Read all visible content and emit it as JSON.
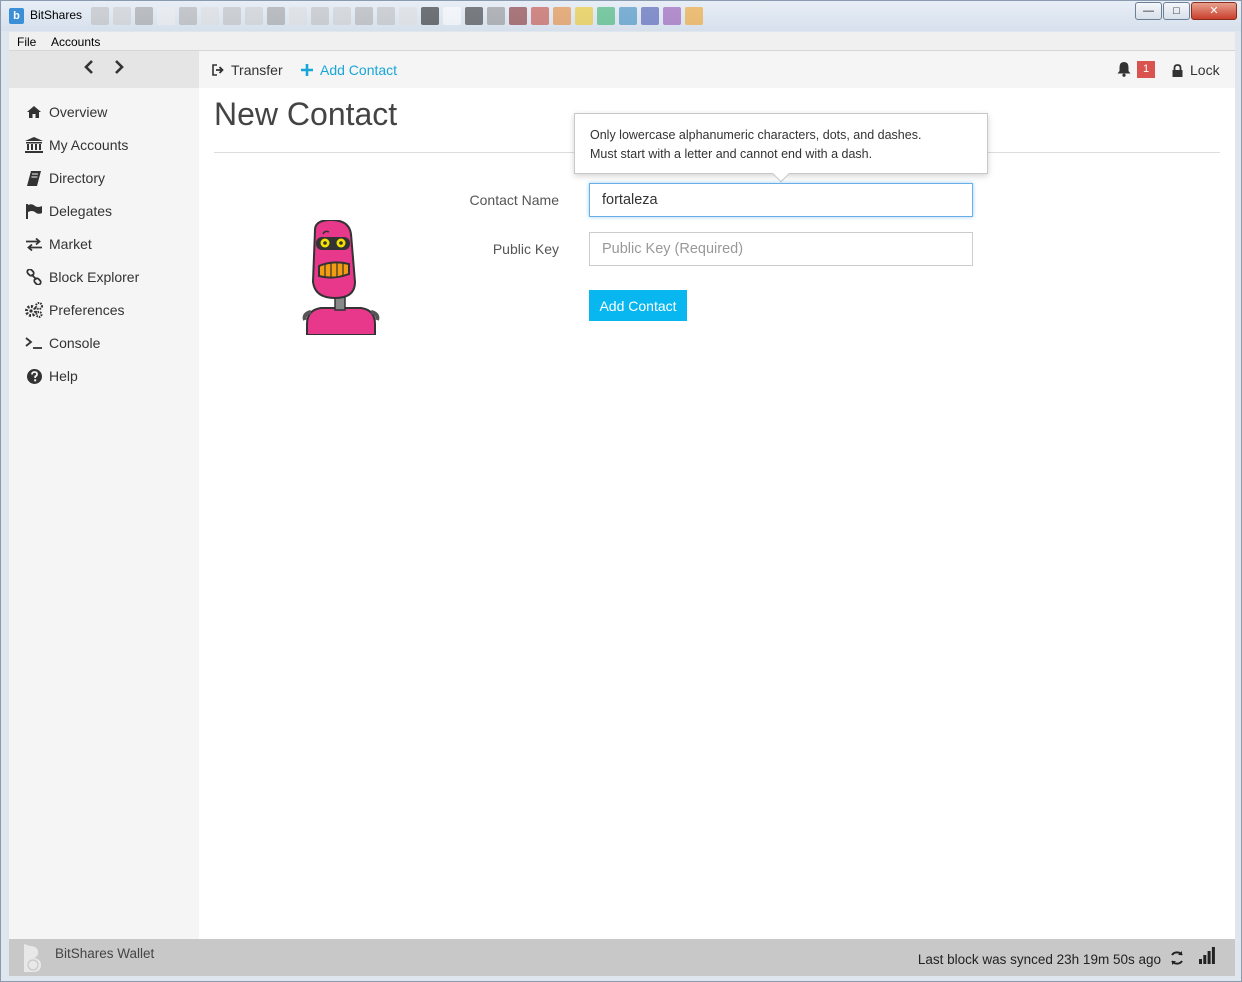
{
  "window": {
    "title": "BitShares",
    "controls": {
      "minimize": "—",
      "maximize": "□",
      "close": "✕"
    }
  },
  "menubar": {
    "items": [
      "File",
      "Accounts"
    ]
  },
  "sidebar": {
    "items": [
      {
        "label": "Overview",
        "icon": "home-icon"
      },
      {
        "label": "My Accounts",
        "icon": "bank-icon"
      },
      {
        "label": "Directory",
        "icon": "book-icon"
      },
      {
        "label": "Delegates",
        "icon": "flag-icon"
      },
      {
        "label": "Market",
        "icon": "exchange-icon"
      },
      {
        "label": "Block Explorer",
        "icon": "link-icon"
      },
      {
        "label": "Preferences",
        "icon": "gears-icon"
      },
      {
        "label": "Console",
        "icon": "terminal-icon"
      },
      {
        "label": "Help",
        "icon": "question-icon"
      }
    ]
  },
  "topbar": {
    "transfer": "Transfer",
    "add_contact": "Add Contact",
    "notifications_count": "1",
    "lock": "Lock"
  },
  "page": {
    "title": "New Contact",
    "tooltip_line1": "Only lowercase alphanumeric characters, dots, and dashes.",
    "tooltip_line2": "Must start with a letter and cannot end with a dash.",
    "contact_name_label": "Contact Name",
    "contact_name_value": "fortaleza",
    "public_key_label": "Public Key",
    "public_key_placeholder": "Public Key (Required)",
    "submit_button": "Add Contact"
  },
  "footer": {
    "brand": "BitShares Wallet",
    "sync_status": "Last block was synced 23h 19m 50s ago"
  },
  "colors": {
    "accent": "#09b7f0",
    "link": "#18a6d9",
    "badge": "#d9534f",
    "robot": "#e8388c"
  }
}
